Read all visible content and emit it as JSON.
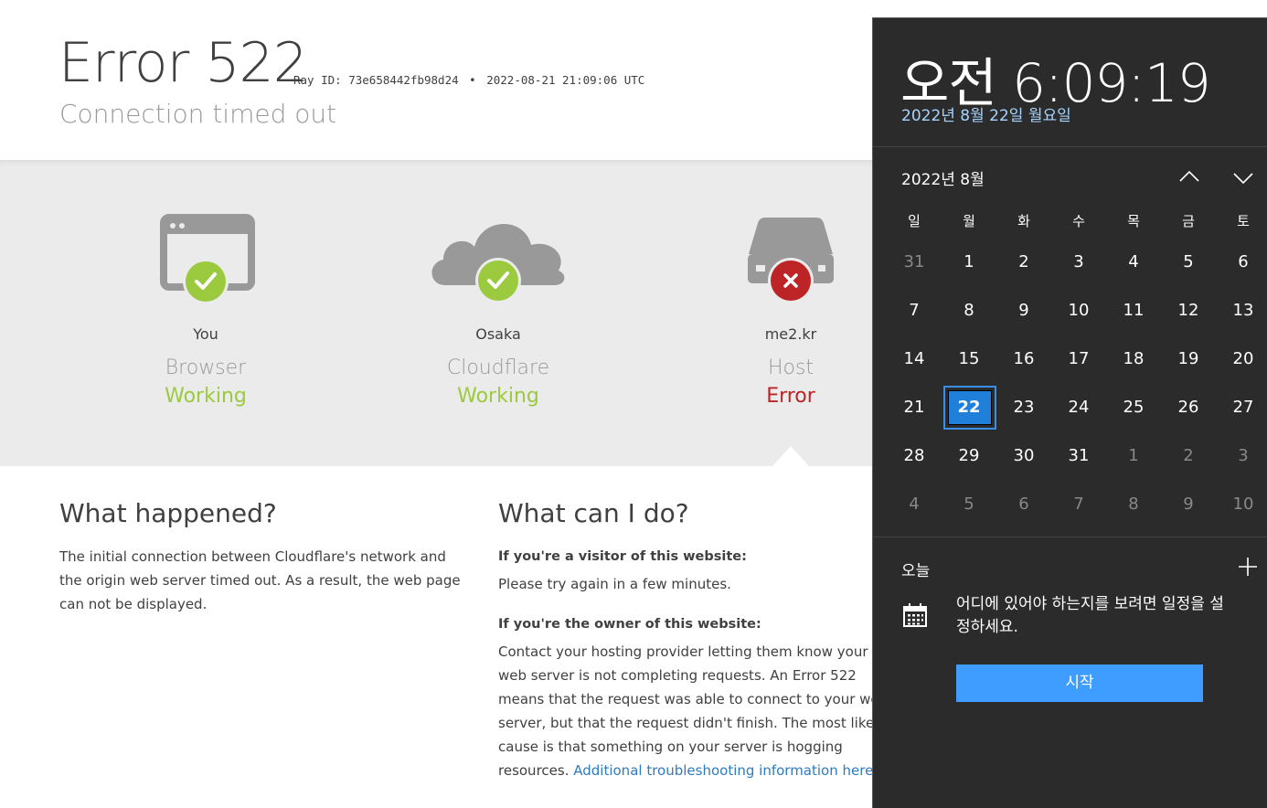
{
  "cf": {
    "code": "Error 522",
    "ray_prefix": "Ray ID:",
    "ray_id": "73e658442fb98d24",
    "bullet": "•",
    "timestamp": "2022-08-21 21:09:06 UTC",
    "subtitle": "Connection timed out",
    "nodes": [
      {
        "location": "You",
        "kind": "Browser",
        "status": "Working",
        "icon": "browser-icon",
        "state": "ok"
      },
      {
        "location": "Osaka",
        "kind": "Cloudflare",
        "status": "Working",
        "icon": "cloud-icon",
        "state": "ok"
      },
      {
        "location": "me2.kr",
        "kind": "Host",
        "status": "Error",
        "icon": "server-icon",
        "state": "error"
      }
    ],
    "what_happened": {
      "title": "What happened?",
      "body": "The initial connection between Cloudflare's network and the origin web server timed out. As a result, the web page can not be displayed."
    },
    "what_can_i_do": {
      "title": "What can I do?",
      "visitor_heading": "If you're a visitor of this website:",
      "visitor_body": "Please try again in a few minutes.",
      "owner_heading": "If you're the owner of this website:",
      "owner_body": "Contact your hosting provider letting them know your web server is not completing requests. An Error 522 means that the request was able to connect to your web server, but that the request didn't finish. The most likely cause is that something on your server is hogging resources.",
      "owner_link": "Additional troubleshooting information here."
    }
  },
  "flyout": {
    "time": "오전 6:09:19",
    "date": "2022년 8월 22일 월요일",
    "month_label": "2022년 8월",
    "weekdays": [
      "일",
      "월",
      "화",
      "수",
      "목",
      "금",
      "토"
    ],
    "weeks": [
      [
        {
          "d": "31",
          "dim": true
        },
        {
          "d": "1"
        },
        {
          "d": "2"
        },
        {
          "d": "3"
        },
        {
          "d": "4"
        },
        {
          "d": "5"
        },
        {
          "d": "6"
        }
      ],
      [
        {
          "d": "7"
        },
        {
          "d": "8"
        },
        {
          "d": "9"
        },
        {
          "d": "10"
        },
        {
          "d": "11"
        },
        {
          "d": "12"
        },
        {
          "d": "13"
        }
      ],
      [
        {
          "d": "14"
        },
        {
          "d": "15"
        },
        {
          "d": "16"
        },
        {
          "d": "17"
        },
        {
          "d": "18"
        },
        {
          "d": "19"
        },
        {
          "d": "20"
        }
      ],
      [
        {
          "d": "21"
        },
        {
          "d": "22",
          "today": true
        },
        {
          "d": "23"
        },
        {
          "d": "24"
        },
        {
          "d": "25"
        },
        {
          "d": "26"
        },
        {
          "d": "27"
        }
      ],
      [
        {
          "d": "28"
        },
        {
          "d": "29"
        },
        {
          "d": "30"
        },
        {
          "d": "31"
        },
        {
          "d": "1",
          "dim": true
        },
        {
          "d": "2",
          "dim": true
        },
        {
          "d": "3",
          "dim": true
        }
      ],
      [
        {
          "d": "4",
          "dim": true
        },
        {
          "d": "5",
          "dim": true
        },
        {
          "d": "6",
          "dim": true
        },
        {
          "d": "7",
          "dim": true
        },
        {
          "d": "8",
          "dim": true
        },
        {
          "d": "9",
          "dim": true
        },
        {
          "d": "10",
          "dim": true
        }
      ]
    ],
    "today_label": "오늘",
    "agenda_message": "어디에 있어야 하는지를 보려면 일정을 설정하세요.",
    "start_button": "시작"
  },
  "colors": {
    "ok": "#9bca3e",
    "error": "#bd2426",
    "icon_gray": "#999999",
    "link": "#2f7bbf",
    "accent": "#3f9dff"
  }
}
